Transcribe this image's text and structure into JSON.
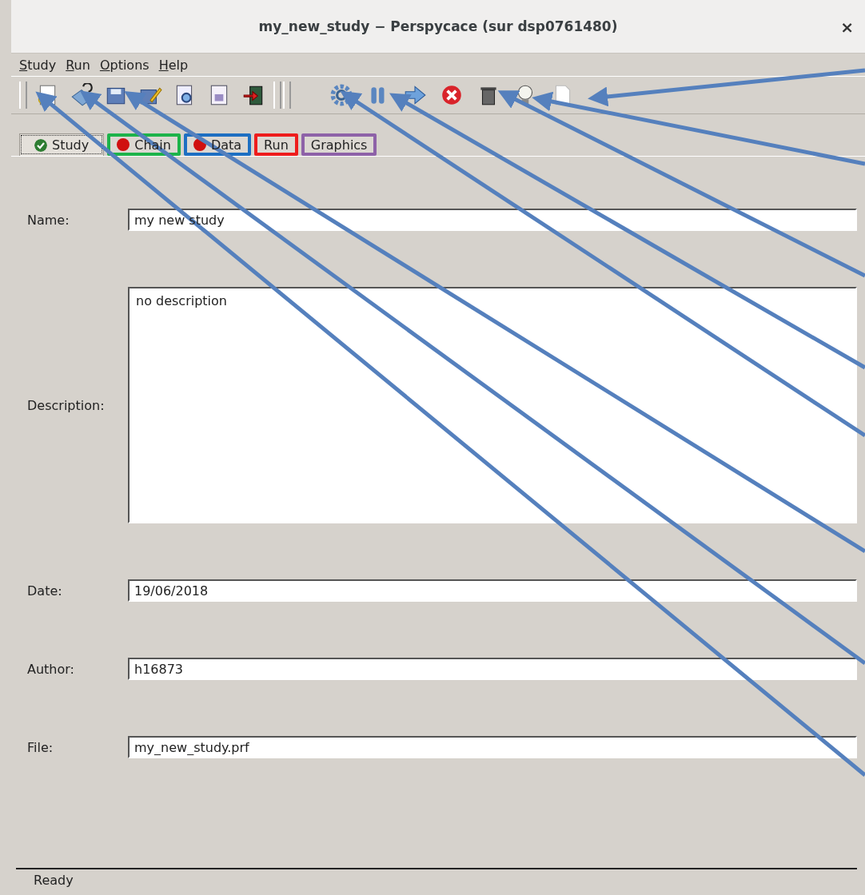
{
  "window": {
    "title": "my_new_study − Perspycace (sur dsp0761480)",
    "close": "×"
  },
  "menu": [
    {
      "label": "Study"
    },
    {
      "label": "Run"
    },
    {
      "label": "Options"
    },
    {
      "label": "Help"
    }
  ],
  "tabs": [
    {
      "label": "Study",
      "selected": true,
      "kind": "ok"
    },
    {
      "label": "Chain",
      "selected": false,
      "kind": "error",
      "color": "#1db34a"
    },
    {
      "label": "Data",
      "selected": false,
      "kind": "error",
      "color": "#1d6fc2"
    },
    {
      "label": "Run",
      "selected": false,
      "kind": "plain",
      "color": "#ee1c1c"
    },
    {
      "label": "Graphics",
      "selected": false,
      "kind": "plain",
      "color": "#8e62a8"
    }
  ],
  "fields": [
    {
      "label": "Name:",
      "value": "my new study",
      "kind": "line"
    },
    {
      "label": "Description:",
      "value": "no description",
      "kind": "area"
    },
    {
      "label": "Date:",
      "value": "19/06/2018",
      "kind": "line"
    },
    {
      "label": "Author:",
      "value": "h16873",
      "kind": "line"
    },
    {
      "label": "File:",
      "value": "my_new_study.prf",
      "kind": "line"
    }
  ],
  "status_bar": "Ready"
}
